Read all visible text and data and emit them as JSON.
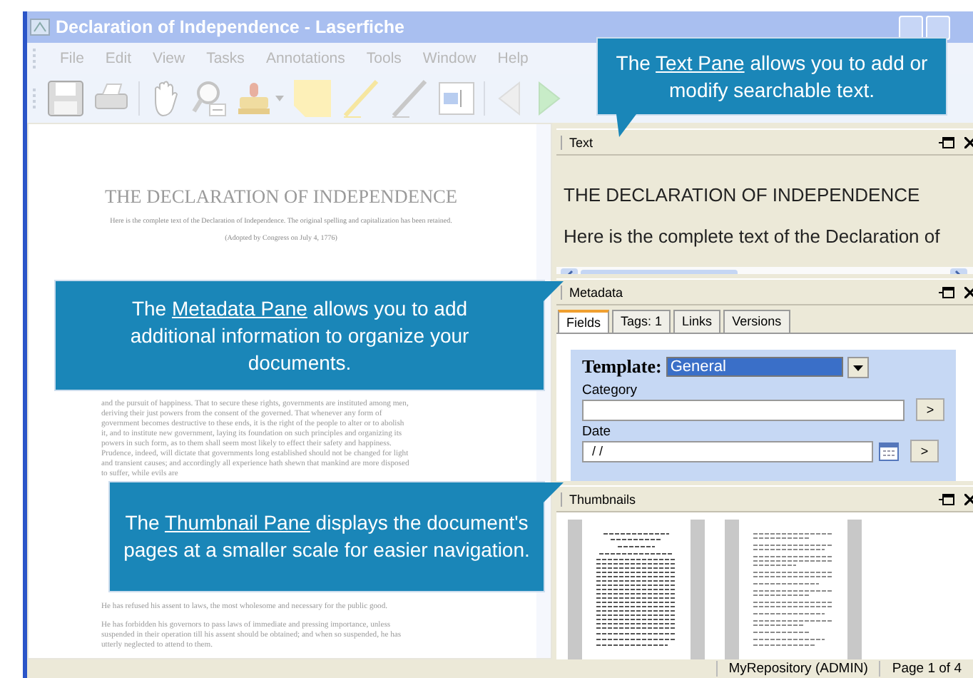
{
  "window": {
    "title": "Declaration of Independence - Laserfiche"
  },
  "menu": [
    {
      "label": "File"
    },
    {
      "label": "Edit"
    },
    {
      "label": "View"
    },
    {
      "label": "Tasks"
    },
    {
      "label": "Annotations"
    },
    {
      "label": "Tools"
    },
    {
      "label": "Window"
    },
    {
      "label": "Help"
    }
  ],
  "document": {
    "title": "THE DECLARATION OF INDEPENDENCE",
    "intro": "Here is the complete text of the Declaration of Independence. The original spelling and capitalization has been retained.",
    "adopted": "(Adopted by Congress on July 4, 1776)",
    "body": [
      "and the pursuit of happiness. That to secure these rights, governments are instituted among men, deriving their just powers from the consent of the governed. That whenever any form of government becomes destructive to these ends, it is the right of the people to alter or to abolish it, and to institute new government, laying its foundation on such principles and organizing its powers in such form, as to them shall seem most likely to effect their safety and happiness. Prudence, indeed, will dictate that governments long established should not be changed for light and transient causes; and accordingly all experience hath shewn that mankind are more disposed to suffer, while evils are",
      "He has refused his assent to laws, the most wholesome and necessary for the public good.",
      "He has forbidden his governors to pass laws of immediate and pressing importance, unless suspended in their operation till his assent should be obtained; and when so suspended, he has utterly neglected to attend to them."
    ]
  },
  "text_pane": {
    "title": "Text",
    "lines": [
      "THE DECLARATION OF INDEPENDENCE",
      "Here is the complete text of the Declaration of"
    ]
  },
  "metadata_pane": {
    "title": "Metadata",
    "tabs": [
      {
        "label": "Fields",
        "selected": true
      },
      {
        "label": "Tags: 1",
        "selected": false
      },
      {
        "label": "Links",
        "selected": false
      },
      {
        "label": "Versions",
        "selected": false
      }
    ],
    "template_label": "Template:",
    "template_value": "General",
    "fields": [
      {
        "label": "Category",
        "kind": "text",
        "button": ">"
      },
      {
        "label": "Date",
        "value": "/ /",
        "kind": "date",
        "button": ">"
      }
    ]
  },
  "thumbnails_pane": {
    "title": "Thumbnails"
  },
  "status_bar": {
    "repository": "MyRepository (ADMIN)",
    "page": "Page 1 of 4"
  },
  "callouts": [
    {
      "lead": "The",
      "link": "Text Pane",
      "rest": "allows you to add or modify searchable text."
    },
    {
      "lead": "The",
      "link": "Metadata Pane",
      "rest": "allows you to add additional information to organize your documents."
    },
    {
      "lead": "The",
      "link": "Thumbnail Pane",
      "rest": "displays the document's pages at a smaller scale for easier navigation."
    }
  ]
}
